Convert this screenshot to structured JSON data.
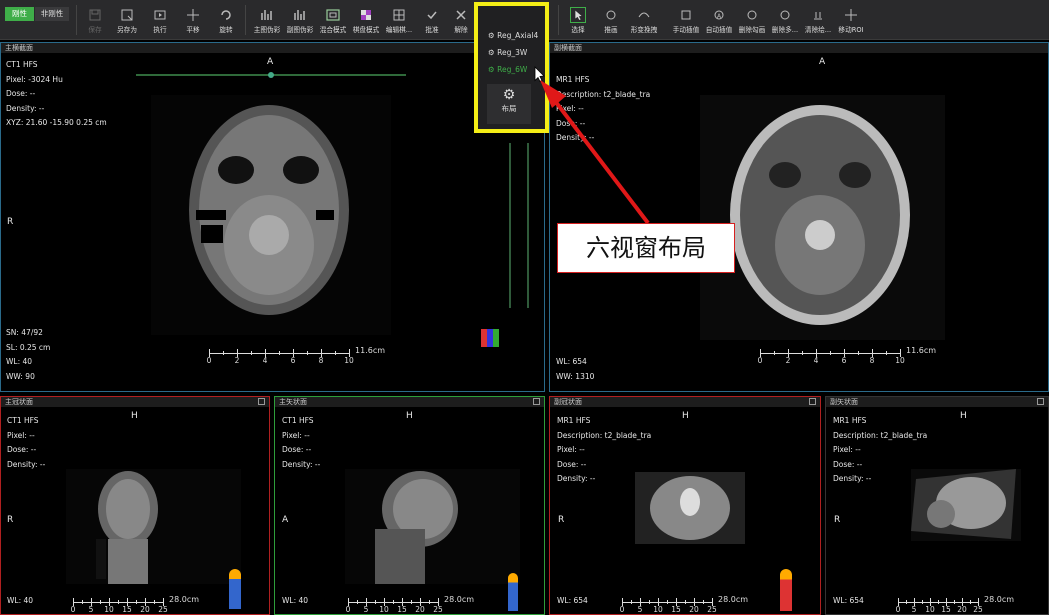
{
  "toolbar": {
    "toggle_rigid": "刚性",
    "toggle_nonrigid": "非刚性",
    "buttons": [
      "保存",
      "另存为",
      "执行",
      "平移",
      "旋转",
      "主图伪彩",
      "副图伪彩",
      "混合模式",
      "棋盘模式",
      "编辑棋...",
      "批准",
      "解除",
      "",
      "",
      "选择",
      "推画",
      "形变挽拽",
      "手动插值",
      "自动插值",
      "删除勾画",
      "删除多...",
      "清除绘...",
      "移动ROI"
    ]
  },
  "layout_popup": {
    "items": [
      "Reg_Axial4",
      "Reg_3W",
      "Reg_6W"
    ],
    "layout_label": "布局"
  },
  "callout": "六视窗布局",
  "views": {
    "main_axial": {
      "title": "主横截面",
      "orient_top": "A",
      "orient_left": "R",
      "info": [
        "CT1 HFS",
        "Pixel:  -3024 Hu",
        "Dose:  --",
        "Density:  --",
        "XYZ: 21.60 -15.90 0.25 cm"
      ],
      "bottom": [
        "SN: 47/92",
        "SL: 0.25 cm",
        "WL:  40",
        "WW:  90"
      ],
      "scale_labels": [
        "0",
        "2",
        "4",
        "6",
        "8",
        "10"
      ],
      "scale_cm": "11.6cm"
    },
    "sub_axial": {
      "title": "副横截面",
      "orient_top": "A",
      "info": [
        "MR1 HFS",
        "Description:  t2_blade_tra",
        "Pixel:  --",
        "Dose:  --",
        "Density:  --"
      ],
      "bottom": [
        "WL:  654",
        "WW:  1310"
      ],
      "scale_labels": [
        "0",
        "2",
        "4",
        "6",
        "8",
        "10"
      ],
      "scale_cm": "11.6cm"
    },
    "main_coronal": {
      "title": "主冠状面",
      "orient_top": "H",
      "orient_left": "R",
      "info": [
        "CT1 HFS",
        "Pixel:  --",
        "Dose:  --",
        "Density:  --"
      ],
      "bottom": [
        "WL:  40"
      ],
      "scale_labels": [
        "0",
        "5",
        "10",
        "15",
        "20",
        "25"
      ],
      "scale_cm": "28.0cm"
    },
    "main_sagittal": {
      "title": "主矢状面",
      "orient_top": "H",
      "orient_left": "A",
      "info": [
        "CT1 HFS",
        "Pixel:  --",
        "Dose:  --",
        "Density:  --"
      ],
      "bottom": [
        "WL:  40"
      ],
      "scale_labels": [
        "0",
        "5",
        "10",
        "15",
        "20",
        "25"
      ],
      "scale_cm": "28.0cm"
    },
    "sub_coronal": {
      "title": "副冠状面",
      "orient_top": "H",
      "orient_left": "R",
      "info": [
        "MR1 HFS",
        "Description:  t2_blade_tra",
        "Pixel:  --",
        "Dose:  --",
        "Density:  --"
      ],
      "bottom": [
        "WL:  654"
      ],
      "scale_labels": [
        "0",
        "5",
        "10",
        "15",
        "20",
        "25"
      ],
      "scale_cm": "28.0cm"
    },
    "sub_sagittal": {
      "title": "副矢状面",
      "orient_top": "H",
      "orient_left": "R",
      "info": [
        "MR1 HFS",
        "Description:  t2_blade_tra",
        "Pixel:  --",
        "Dose:  --",
        "Density:  --"
      ],
      "bottom": [
        "WL:  654"
      ],
      "scale_labels": [
        "0",
        "5",
        "10",
        "15",
        "20",
        "25"
      ],
      "scale_cm": "28.0cm"
    }
  },
  "colors": {
    "active_green": "#3fae49",
    "highlight_yellow": "#f4ee16",
    "arrow_red": "#e01818",
    "frame_red": "#b02020",
    "frame_green": "#2e9e3a",
    "frame_blue": "#2a6a8a"
  }
}
